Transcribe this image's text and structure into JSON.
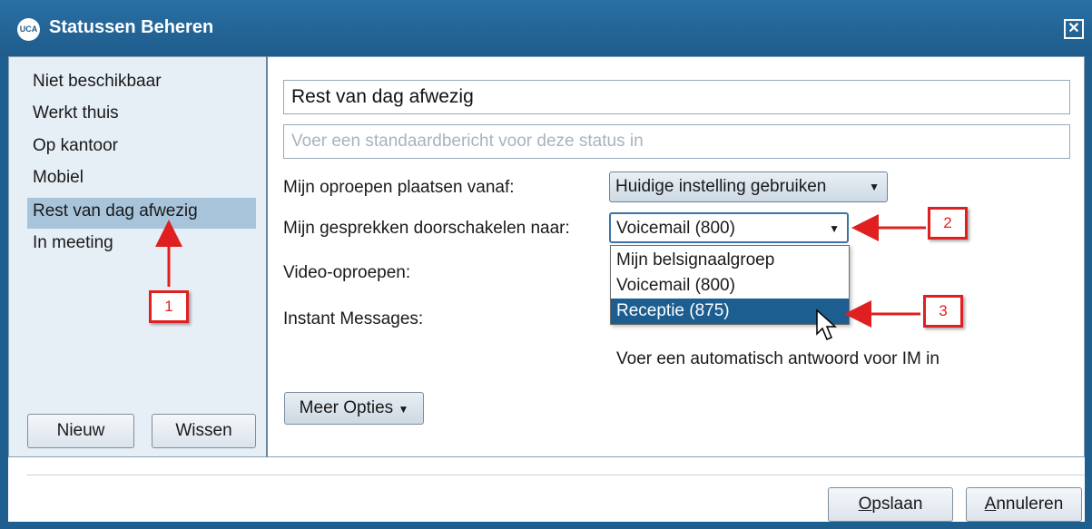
{
  "window": {
    "logo_text": "UCA",
    "title": "Statussen Beheren",
    "close_glyph": "✕"
  },
  "status_list": [
    {
      "label": "Niet beschikbaar",
      "selected": false
    },
    {
      "label": "Werkt thuis",
      "selected": false
    },
    {
      "label": "Op kantoor",
      "selected": false
    },
    {
      "label": "Mobiel",
      "selected": false
    },
    {
      "label": "Rest van dag afwezig",
      "selected": true
    },
    {
      "label": "In meeting",
      "selected": false
    }
  ],
  "left_buttons": {
    "new": "Nieuw",
    "delete": "Wissen"
  },
  "form": {
    "status_name": "Rest van dag afwezig",
    "message_placeholder": "Voer een standaardbericht voor deze status in",
    "calls_from_label": "Mijn oproepen plaatsen vanaf:",
    "calls_from_value": "Huidige instelling gebruiken",
    "forward_label": "Mijn gesprekken doorschakelen naar:",
    "forward_value": "Voicemail (800)",
    "forward_options": [
      "Mijn belsignaalgroep",
      "Voicemail (800)",
      "Receptie (875)"
    ],
    "forward_highlighted_index": 2,
    "video_label": "Video-oproepen:",
    "im_label": "Instant Messages:",
    "im_hint": "Voer een automatisch antwoord voor IM in",
    "more_options": "Meer Opties"
  },
  "footer": {
    "save": "Opslaan",
    "cancel": "Annuleren"
  },
  "annotations": {
    "callout_1": "1",
    "callout_2": "2",
    "callout_3": "3",
    "color": "#e02020"
  },
  "colors": {
    "titlebar": "#1e5c8c",
    "selection": "#a8c4da",
    "dropdown_highlight": "#1b5e8f"
  }
}
